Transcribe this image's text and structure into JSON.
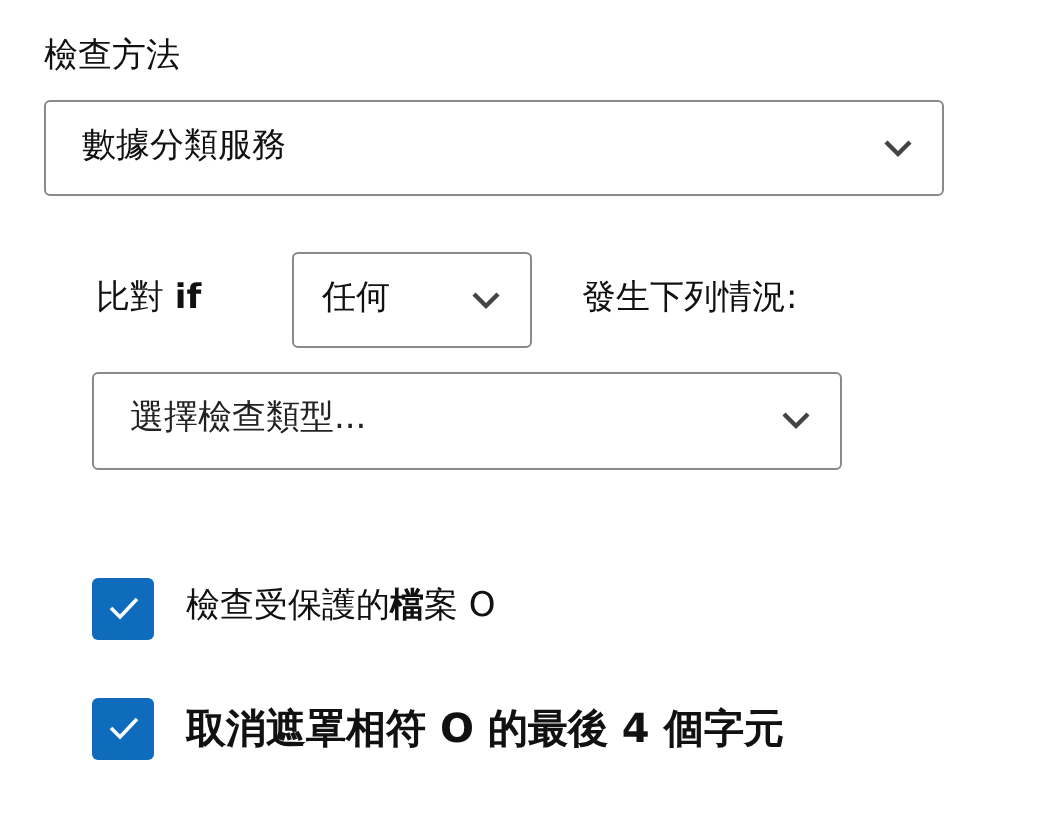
{
  "check_method": {
    "label": "檢查方法",
    "value": "數據分類服務"
  },
  "match": {
    "label": "比對 **if**",
    "value": "任何",
    "suffix": "發生下列情況:"
  },
  "check_type": {
    "placeholder": "選擇檢查類型..."
  },
  "options": [
    {
      "label": "檢查受保護的**檔**案 O",
      "checked": true,
      "bold": false
    },
    {
      "label": "取消遮罩相符 O 的最後 4 個字元",
      "checked": true,
      "bold": true
    }
  ]
}
